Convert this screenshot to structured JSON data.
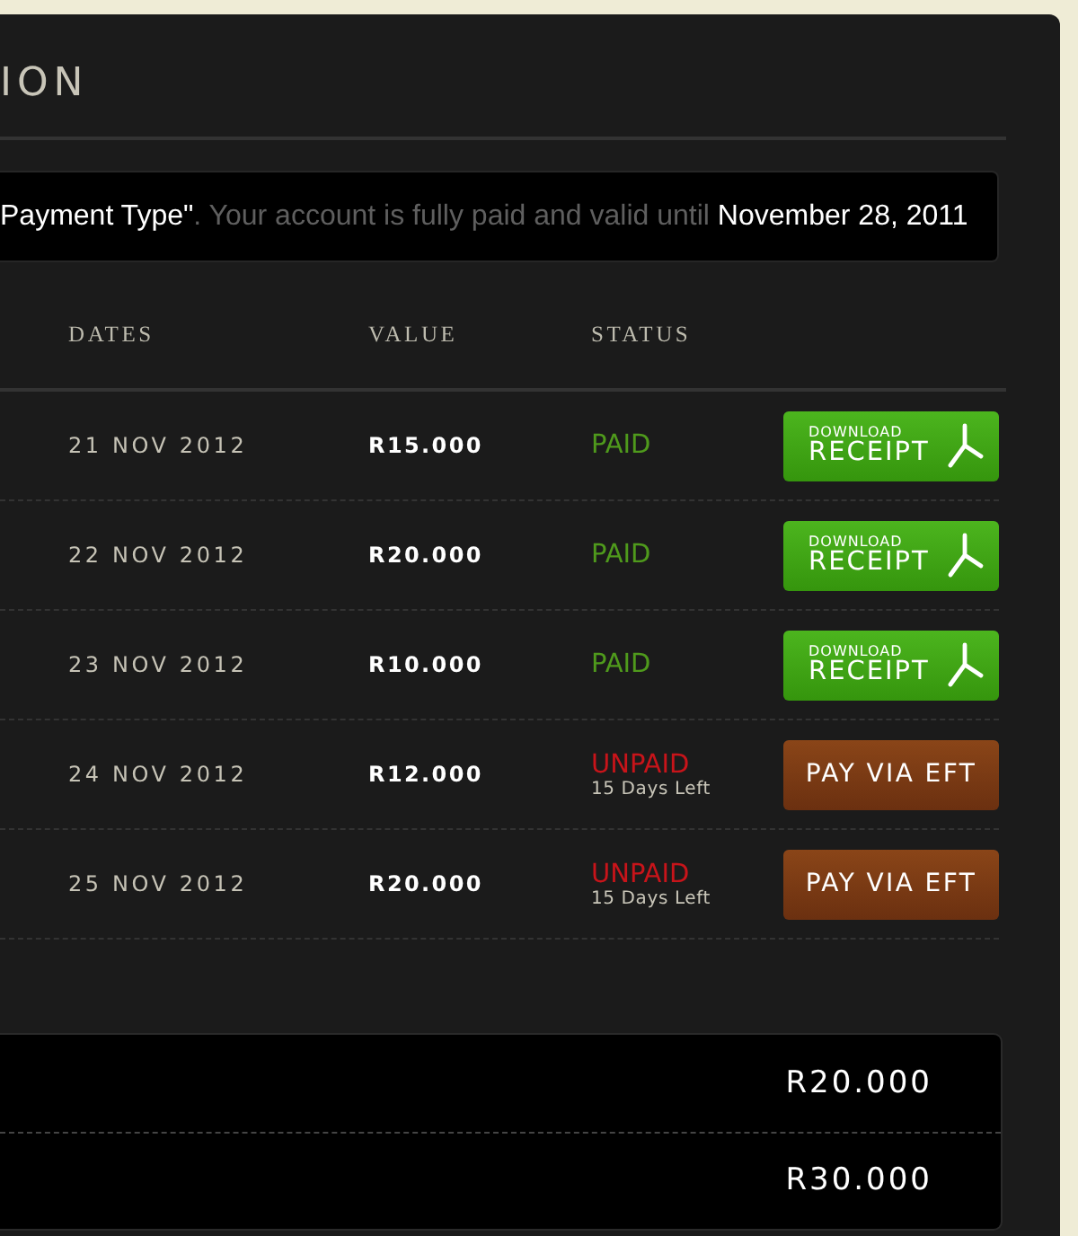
{
  "title": "ION",
  "notice": "**Payment Type\"**. Your account is fully paid and valid until **November 28, 2011**",
  "table": {
    "columns": [
      "DATES",
      "VALUE",
      "STATUS"
    ],
    "rows": [
      {
        "date": "21 NOV 2012",
        "value": "R15.000",
        "status": {
          "kind": "paid",
          "label": "PAID"
        },
        "action": {
          "kind": "receipt",
          "small": "DOWNLOAD",
          "big": "RECEIPT"
        }
      },
      {
        "date": "22 NOV 2012",
        "value": "R20.000",
        "status": {
          "kind": "paid",
          "label": "PAID"
        },
        "action": {
          "kind": "receipt",
          "small": "DOWNLOAD",
          "big": "RECEIPT"
        }
      },
      {
        "date": "23 NOV 2012",
        "value": "R10.000",
        "status": {
          "kind": "paid",
          "label": "PAID"
        },
        "action": {
          "kind": "receipt",
          "small": "DOWNLOAD",
          "big": "RECEIPT"
        }
      },
      {
        "date": "24 NOV 2012",
        "value": "R12.000",
        "status": {
          "kind": "unpaid",
          "label": "UNPAID",
          "note": "15 Days Left"
        },
        "action": {
          "kind": "eft",
          "label": "PAY VIA EFT"
        }
      },
      {
        "date": "25 NOV 2012",
        "value": "R20.000",
        "status": {
          "kind": "unpaid",
          "label": "UNPAID",
          "note": "15 Days Left"
        },
        "action": {
          "kind": "eft",
          "label": "PAY VIA EFT"
        }
      }
    ]
  },
  "totals": [
    "R20.000",
    "R30.000"
  ]
}
